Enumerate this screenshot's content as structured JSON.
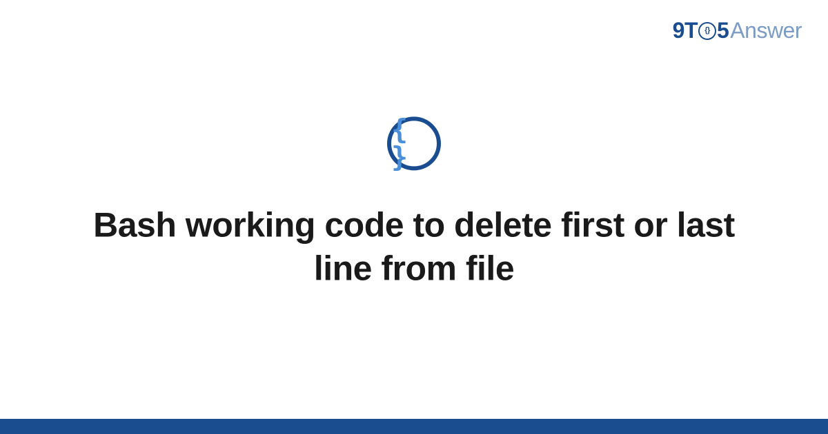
{
  "brand": {
    "prefix": "9T",
    "ring_inner": "{}",
    "suffix": "5",
    "word": "Answer"
  },
  "icon": {
    "glyph": "{ }",
    "name": "code-braces-icon"
  },
  "title": "Bash working code to delete first or last line from file",
  "colors": {
    "primary": "#1a4d8f",
    "accent": "#4a8fd8",
    "muted": "#7a9cc6",
    "text": "#1a1a1a",
    "background": "#ffffff"
  }
}
